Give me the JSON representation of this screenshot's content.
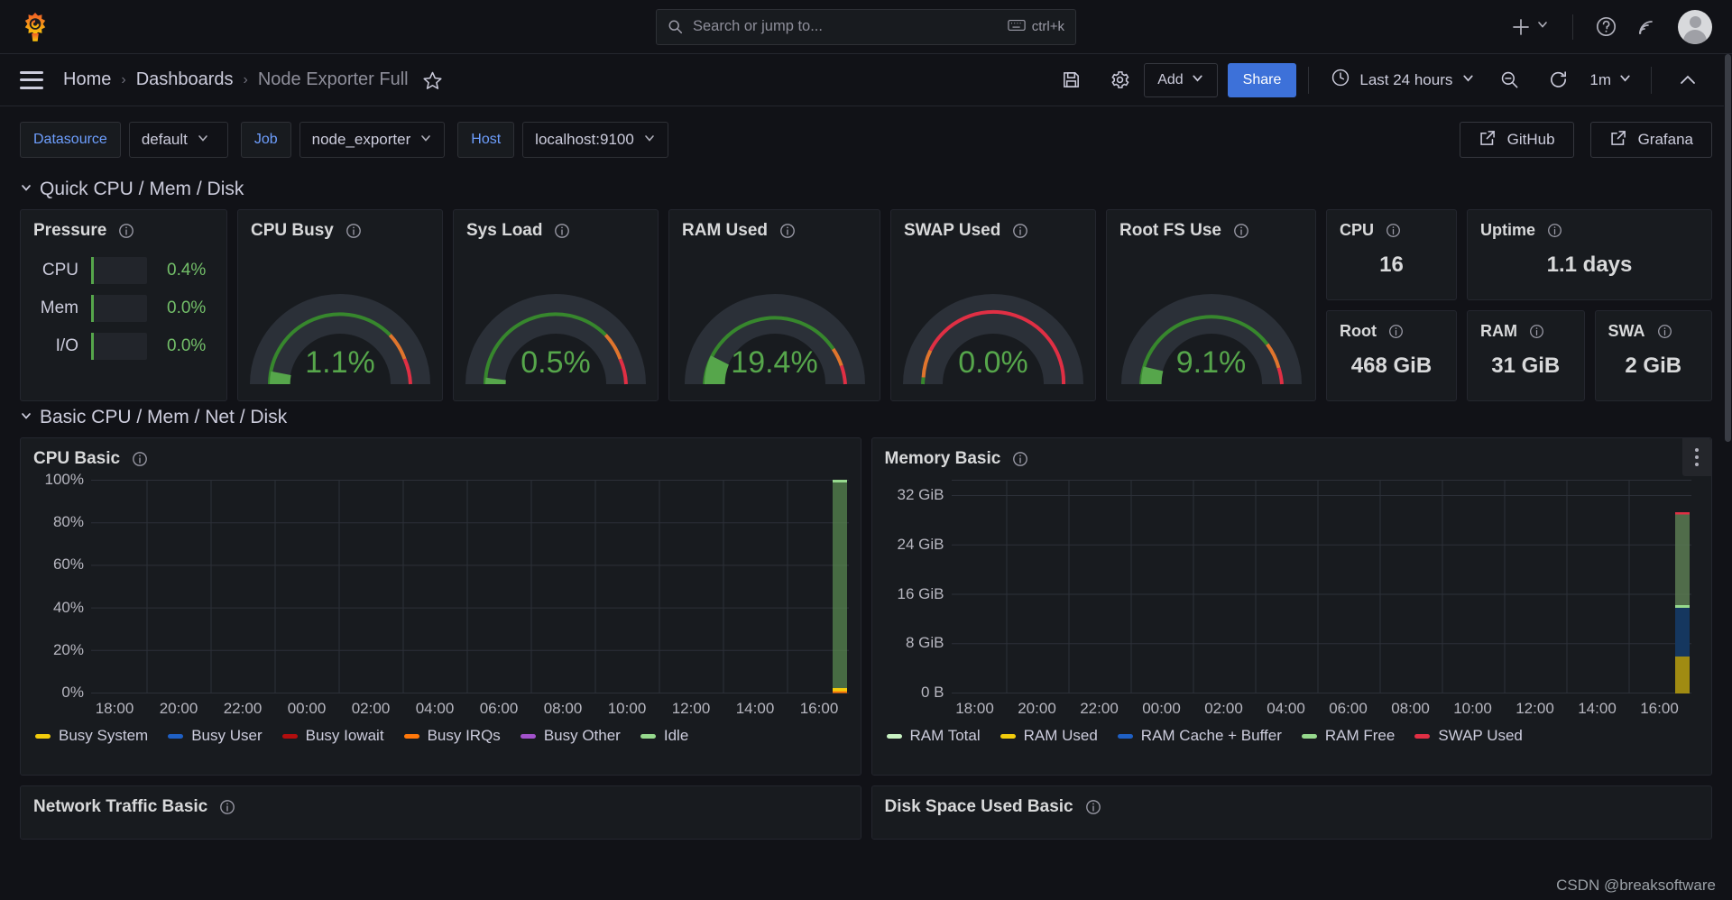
{
  "topnav": {
    "logo_icon": "grafana-logo-icon",
    "search": {
      "icon": "search-icon",
      "placeholder": "Search or jump to...",
      "shortcut": "ctrl+k",
      "shortcut_icon": "keyboard-icon"
    },
    "new_label": "+",
    "help_icon": "help-circle-icon",
    "news_icon": "rss-icon",
    "avatar_icon": "user-avatar"
  },
  "breadcrumb": {
    "menu_icon": "hamburger-menu-icon",
    "items": [
      {
        "label": "Home"
      },
      {
        "label": "Dashboards"
      },
      {
        "label": "Node Exporter Full"
      }
    ],
    "separator": "›",
    "star_icon": "star-outline-icon"
  },
  "toolbar": {
    "save_icon": "save-disk-icon",
    "settings_icon": "gear-icon",
    "add_label": "Add",
    "share_label": "Share",
    "time_icon": "clock-icon",
    "time_range": "Last 24 hours",
    "zoom_out_icon": "zoom-out-icon",
    "refresh_icon": "refresh-icon",
    "refresh_interval": "1m",
    "collapse_icon": "chevron-up-icon"
  },
  "variables": [
    {
      "name": "datasource",
      "label": "Datasource",
      "value": "default"
    },
    {
      "name": "job",
      "label": "Job",
      "value": "node_exporter"
    },
    {
      "name": "host",
      "label": "Host",
      "value": "localhost:9100"
    }
  ],
  "links": [
    {
      "name": "github-link",
      "label": "GitHub",
      "icon": "external-link-icon"
    },
    {
      "name": "grafana-link",
      "label": "Grafana",
      "icon": "external-link-icon"
    }
  ],
  "rows": [
    {
      "name": "quick-cpu-mem-disk",
      "title": "Quick CPU / Mem / Disk",
      "collapsed": false
    },
    {
      "name": "basic-cpu-mem-net-disk",
      "title": "Basic CPU / Mem / Net / Disk",
      "collapsed": false
    }
  ],
  "pressure_panel": {
    "title": "Pressure",
    "info_icon": "info-circle-icon",
    "rows": [
      {
        "label": "CPU",
        "value": "0.4%",
        "pct": 0.4
      },
      {
        "label": "Mem",
        "value": "0.0%",
        "pct": 0.0
      },
      {
        "label": "I/O",
        "value": "0.0%",
        "pct": 0.0
      }
    ]
  },
  "gauges": [
    {
      "name": "cpu-busy",
      "title": "CPU Busy",
      "value": "1.1%",
      "pct": 1.1,
      "scheme": "green"
    },
    {
      "name": "sys-load",
      "title": "Sys Load",
      "value": "0.5%",
      "pct": 0.5,
      "scheme": "green"
    },
    {
      "name": "ram-used",
      "title": "RAM Used",
      "value": "19.4%",
      "pct": 19.4,
      "scheme": "green"
    },
    {
      "name": "swap-used",
      "title": "SWAP Used",
      "value": "0.0%",
      "pct": 0.0,
      "scheme": "red"
    },
    {
      "name": "root-fs-use",
      "title": "Root FS Use",
      "value": "9.1%",
      "pct": 9.1,
      "scheme": "green"
    }
  ],
  "stats": [
    {
      "name": "cpu-cores",
      "title": "CPU",
      "value": "16"
    },
    {
      "name": "uptime",
      "title": "Uptime",
      "value": "1.1 days"
    },
    {
      "name": "root-size",
      "title": "Root",
      "value": "468 GiB"
    },
    {
      "name": "ram-total",
      "title": "RAM",
      "value": "31 GiB"
    },
    {
      "name": "swap-total",
      "title": "SWA",
      "value": "2 GiB"
    }
  ],
  "info_icon": "info-circle-icon",
  "bottom_panels": [
    {
      "name": "network-traffic-basic",
      "title": "Network Traffic Basic"
    },
    {
      "name": "disk-space-used-basic",
      "title": "Disk Space Used Basic"
    }
  ],
  "watermark": "CSDN @breaksoftware",
  "chart_data": [
    {
      "name": "cpu-basic",
      "type": "area",
      "title": "CPU Basic",
      "xlabel": "",
      "ylabel": "",
      "ylim": [
        0,
        100
      ],
      "yticks": [
        "0%",
        "20%",
        "40%",
        "60%",
        "80%",
        "100%"
      ],
      "xticks": [
        "18:00",
        "20:00",
        "22:00",
        "00:00",
        "02:00",
        "04:00",
        "06:00",
        "08:00",
        "10:00",
        "12:00",
        "14:00",
        "16:00"
      ],
      "grid": true,
      "legend_position": "bottom",
      "series": [
        {
          "name": "Busy System",
          "color": "#f2cc0c",
          "values": [
            0,
            0,
            0,
            0,
            0,
            0,
            0,
            0,
            0,
            0,
            0,
            0,
            0.4
          ]
        },
        {
          "name": "Busy User",
          "color": "#1f60c4",
          "values": [
            0,
            0,
            0,
            0,
            0,
            0,
            0,
            0,
            0,
            0,
            0,
            0,
            0.6
          ]
        },
        {
          "name": "Busy Iowait",
          "color": "#b20e0e",
          "values": [
            0,
            0,
            0,
            0,
            0,
            0,
            0,
            0,
            0,
            0,
            0,
            0,
            0.1
          ]
        },
        {
          "name": "Busy IRQs",
          "color": "#ff780a",
          "values": [
            0,
            0,
            0,
            0,
            0,
            0,
            0,
            0,
            0,
            0,
            0,
            0,
            0.1
          ]
        },
        {
          "name": "Busy Other",
          "color": "#a352cc",
          "values": [
            0,
            0,
            0,
            0,
            0,
            0,
            0,
            0,
            0,
            0,
            0,
            0,
            0.0
          ]
        },
        {
          "name": "Idle",
          "color": "#96d98d",
          "values": [
            0,
            0,
            0,
            0,
            0,
            0,
            0,
            0,
            0,
            0,
            0,
            0,
            98.8
          ]
        }
      ]
    },
    {
      "name": "memory-basic",
      "type": "area",
      "title": "Memory Basic",
      "xlabel": "",
      "ylabel": "",
      "ylim": [
        0,
        34
      ],
      "yticks": [
        "0 B",
        "8 GiB",
        "16 GiB",
        "24 GiB",
        "32 GiB"
      ],
      "xticks": [
        "18:00",
        "20:00",
        "22:00",
        "00:00",
        "02:00",
        "04:00",
        "06:00",
        "08:00",
        "10:00",
        "12:00",
        "14:00",
        "16:00"
      ],
      "grid": true,
      "legend_position": "bottom",
      "series": [
        {
          "name": "RAM Total",
          "color": "#c8f2c2",
          "values": [
            0,
            0,
            0,
            0,
            0,
            0,
            0,
            0,
            0,
            0,
            0,
            0,
            31
          ]
        },
        {
          "name": "RAM Used",
          "color": "#f2cc0c",
          "values": [
            0,
            0,
            0,
            0,
            0,
            0,
            0,
            0,
            0,
            0,
            0,
            0,
            6
          ]
        },
        {
          "name": "RAM Cache + Buffer",
          "color": "#1f60c4",
          "values": [
            0,
            0,
            0,
            0,
            0,
            0,
            0,
            0,
            0,
            0,
            0,
            0,
            10
          ]
        },
        {
          "name": "RAM Free",
          "color": "#96d98d",
          "values": [
            0,
            0,
            0,
            0,
            0,
            0,
            0,
            0,
            0,
            0,
            0,
            0,
            15
          ]
        },
        {
          "name": "SWAP Used",
          "color": "#e02f44",
          "values": [
            0,
            0,
            0,
            0,
            0,
            0,
            0,
            0,
            0,
            0,
            0,
            0,
            0.4
          ]
        }
      ]
    }
  ]
}
